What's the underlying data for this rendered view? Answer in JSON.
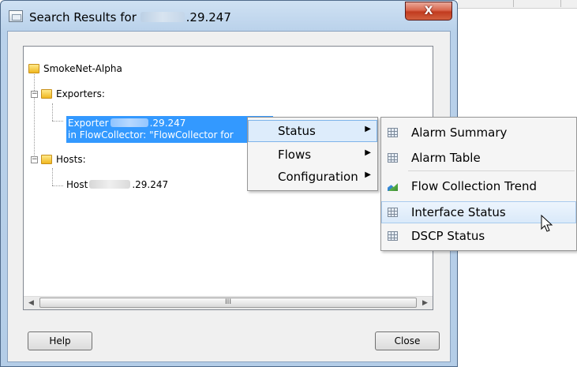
{
  "window": {
    "title_prefix": "Search Results for",
    "title_suffix": ".29.247",
    "close_glyph": "X"
  },
  "tree": {
    "root_label": "SmokeNet-Alpha",
    "exporters_label": "Exporters:",
    "exporter_line1_prefix": "Exporter",
    "exporter_line1_suffix": ".29.247",
    "exporter_line2": "in FlowCollector: \"FlowCollector for",
    "hosts_label": "Hosts:",
    "host_prefix": "Host",
    "host_suffix": ".29.247",
    "scroll_thumb_grip": "III"
  },
  "buttons": {
    "help": "Help",
    "close": "Close"
  },
  "context_menu": {
    "items": [
      "Status",
      "Flows",
      "Configuration"
    ]
  },
  "submenu": {
    "items": [
      "Alarm Summary",
      "Alarm Table",
      "Flow Collection Trend",
      "Interface Status",
      "DSCP Status"
    ]
  },
  "colors": {
    "selection": "#3399ff",
    "menu_highlight": "#ddecfb",
    "close_button_red": "#c13b1f"
  }
}
